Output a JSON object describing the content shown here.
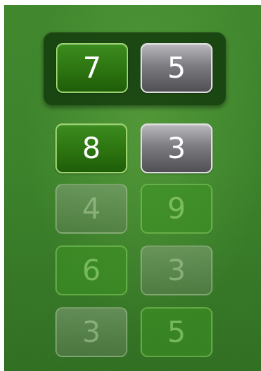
{
  "current_round": {
    "player_score": "7",
    "opponent_score": "5"
  },
  "history": [
    {
      "player_score": "8",
      "opponent_score": "3"
    },
    {
      "player_score": "4",
      "opponent_score": "9"
    },
    {
      "player_score": "6",
      "opponent_score": "3"
    },
    {
      "player_score": "3",
      "opponent_score": "5"
    }
  ],
  "colors": {
    "felt_green": "#3a8428",
    "player_tile": "#2c7410",
    "opponent_tile": "#7c7c81",
    "tile_text": "#ffffff"
  }
}
